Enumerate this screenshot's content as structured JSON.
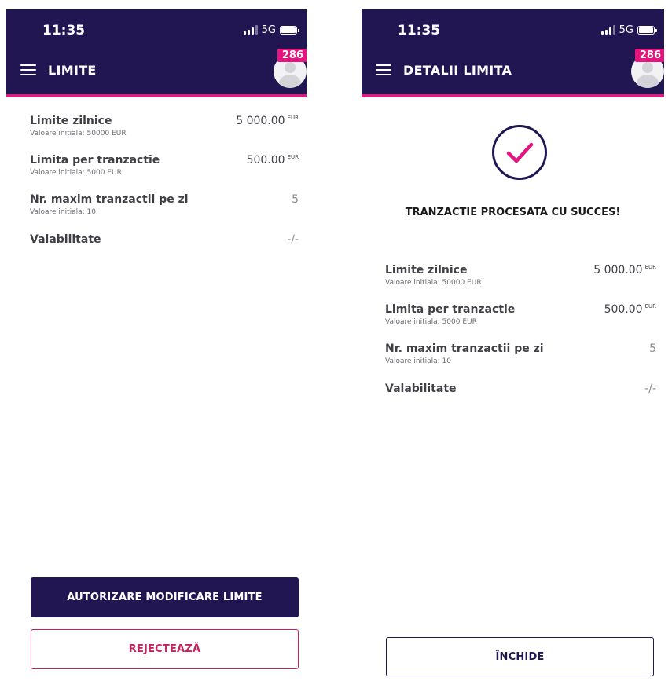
{
  "colors": {
    "brand": "#221652",
    "accent": "#d6207c",
    "reject": "#c0245d",
    "badge": "#e4157e"
  },
  "left": {
    "status": {
      "time": "11:35",
      "network": "5G"
    },
    "header": {
      "title": "LIMITE",
      "badge": "286"
    },
    "limits": [
      {
        "label": "Limite zilnice",
        "sub": "Valoare initiala: 50000 EUR",
        "value": "5 000.00",
        "unit": "EUR"
      },
      {
        "label": "Limita per tranzactie",
        "sub": "Valoare initiala: 5000 EUR",
        "value": "500.00",
        "unit": "EUR"
      },
      {
        "label": "Nr. maxim tranzactii pe zi",
        "sub": "Valoare initiala: 10",
        "value": "5"
      },
      {
        "label": "Valabilitate",
        "value": "-/-"
      }
    ],
    "buttons": {
      "authorize": "AUTORIZARE MODIFICARE LIMITE",
      "reject": "REJECTEAZĂ"
    }
  },
  "right": {
    "status": {
      "time": "11:35",
      "network": "5G"
    },
    "header": {
      "title": "DETALII LIMITA",
      "badge": "286"
    },
    "icon": "check-circle-icon",
    "success_message": "TRANZACTIE PROCESATA CU SUCCES!",
    "limits": [
      {
        "label": "Limite zilnice",
        "sub": "Valoare initiala: 50000 EUR",
        "value": "5 000.00",
        "unit": "EUR"
      },
      {
        "label": "Limita per tranzactie",
        "sub": "Valoare initiala: 5000 EUR",
        "value": "500.00",
        "unit": "EUR"
      },
      {
        "label": "Nr. maxim tranzactii pe zi",
        "sub": "Valoare initiala: 10",
        "value": "5"
      },
      {
        "label": "Valabilitate",
        "value": "-/-"
      }
    ],
    "buttons": {
      "close": "ÎNCHIDE"
    }
  }
}
